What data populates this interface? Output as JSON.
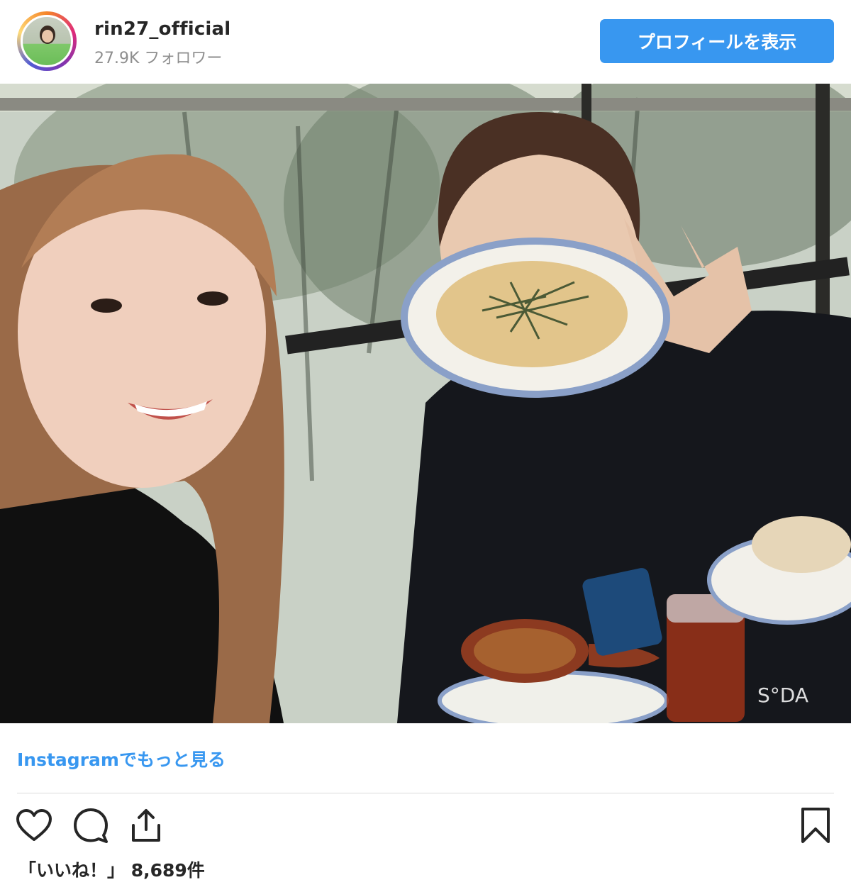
{
  "post": {
    "username": "rin27_official",
    "followers": "27.9K フォロワー",
    "profile_button": "プロフィールを表示",
    "photo_alt": "",
    "watermark": "S°DA",
    "more_link": "Instagramでもっと見る",
    "likes": "「いいね！」 8,689件"
  },
  "icons": {
    "like": "heart-icon",
    "comment": "comment-icon",
    "share": "share-icon",
    "save": "bookmark-icon"
  },
  "colors": {
    "accent": "#3897f0",
    "text": "#262626",
    "muted": "#8e8e8e",
    "divider": "#dbdbdb"
  }
}
